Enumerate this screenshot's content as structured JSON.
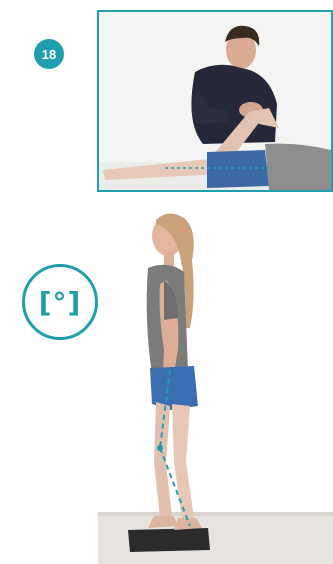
{
  "step": {
    "number": "18"
  },
  "icons": {
    "measure": "angle-measurement-icon",
    "measure_text": "[°]"
  },
  "colors": {
    "accent": "#1f9fae"
  }
}
